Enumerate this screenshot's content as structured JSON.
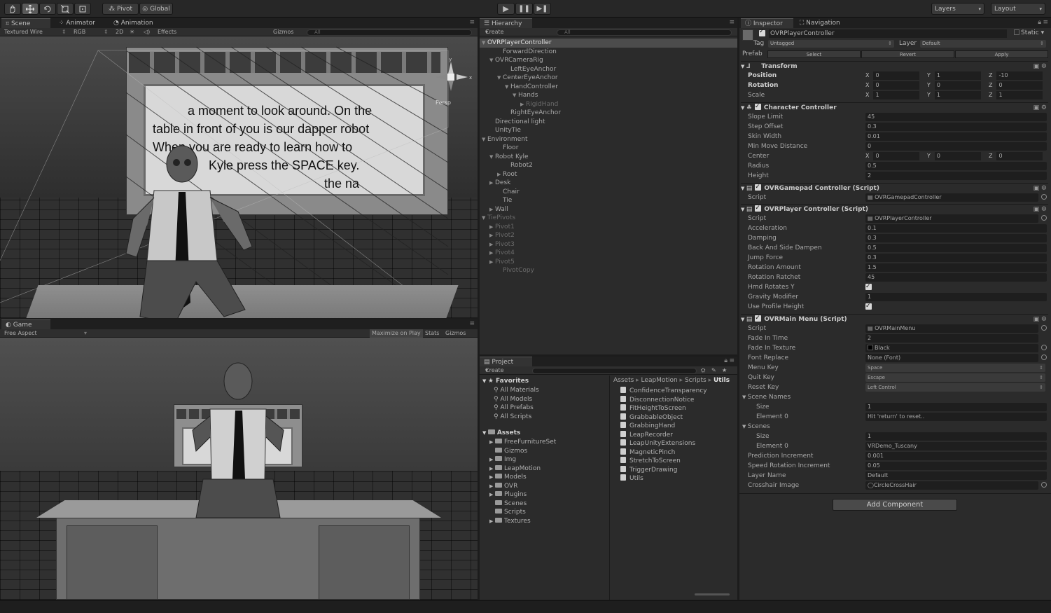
{
  "toolbar": {
    "pivot": "Pivot",
    "global": "Global",
    "layers": "Layers",
    "layout": "Layout"
  },
  "scene": {
    "tabs": [
      "Scene",
      "Animator",
      "Animation"
    ],
    "shading": "Textured Wire",
    "render_mode": "RGB",
    "mode_2d": "2D",
    "effects": "Effects",
    "gizmos": "Gizmos",
    "search": "All",
    "persp": "Persp",
    "board_text": [
      "a moment to look around. On the",
      "table in front of you is our dapper robot",
      "When you are ready to learn how to",
      "Kyle press the SPACE key.",
      "the na"
    ]
  },
  "game": {
    "tab": "Game",
    "aspect": "Free Aspect",
    "maximize": "Maximize on Play",
    "stats": "Stats",
    "gizmos": "Gizmos"
  },
  "hierarchy": {
    "tab": "Hierarchy",
    "create": "Create",
    "search": "All",
    "rows": [
      {
        "label": "OVRPlayerController",
        "indent": 0,
        "arrow": "▼",
        "selected": true
      },
      {
        "label": "ForwardDirection",
        "indent": 2,
        "arrow": ""
      },
      {
        "label": "OVRCameraRig",
        "indent": 1,
        "arrow": "▼"
      },
      {
        "label": "LeftEyeAnchor",
        "indent": 3,
        "arrow": ""
      },
      {
        "label": "CenterEyeAnchor",
        "indent": 2,
        "arrow": "▼"
      },
      {
        "label": "HandController",
        "indent": 3,
        "arrow": "▼"
      },
      {
        "label": "Hands",
        "indent": 4,
        "arrow": "▼"
      },
      {
        "label": "RigidHand",
        "indent": 5,
        "arrow": "▶",
        "dim": true
      },
      {
        "label": "RightEyeAnchor",
        "indent": 3,
        "arrow": ""
      },
      {
        "label": "Directional light",
        "indent": 1,
        "arrow": ""
      },
      {
        "label": "UnityTie",
        "indent": 1,
        "arrow": ""
      },
      {
        "label": "Environment",
        "indent": 0,
        "arrow": "▼"
      },
      {
        "label": "Floor",
        "indent": 2,
        "arrow": ""
      },
      {
        "label": "Robot Kyle",
        "indent": 1,
        "arrow": "▼"
      },
      {
        "label": "Robot2",
        "indent": 3,
        "arrow": ""
      },
      {
        "label": "Root",
        "indent": 2,
        "arrow": "▶"
      },
      {
        "label": "Desk",
        "indent": 1,
        "arrow": "▶"
      },
      {
        "label": "Chair",
        "indent": 2,
        "arrow": ""
      },
      {
        "label": "Tie",
        "indent": 2,
        "arrow": ""
      },
      {
        "label": "Wall",
        "indent": 1,
        "arrow": "▶"
      },
      {
        "label": "TiePivots",
        "indent": 0,
        "arrow": "▼",
        "dim": true
      },
      {
        "label": "Pivot1",
        "indent": 1,
        "arrow": "▶",
        "dim": true
      },
      {
        "label": "Pivot2",
        "indent": 1,
        "arrow": "▶",
        "dim": true
      },
      {
        "label": "Pivot3",
        "indent": 1,
        "arrow": "▶",
        "dim": true
      },
      {
        "label": "Pivot4",
        "indent": 1,
        "arrow": "▶",
        "dim": true
      },
      {
        "label": "Pivot5",
        "indent": 1,
        "arrow": "▶",
        "dim": true
      },
      {
        "label": "PivotCopy",
        "indent": 2,
        "arrow": "",
        "dim": true
      }
    ]
  },
  "project": {
    "tab": "Project",
    "create": "Create",
    "favorites_label": "Favorites",
    "favorites": [
      "All Materials",
      "All Models",
      "All Prefabs",
      "All Scripts"
    ],
    "assets_label": "Assets",
    "folders": [
      {
        "label": "FreeFurnitureSet",
        "arrow": "▶"
      },
      {
        "label": "Gizmos",
        "arrow": ""
      },
      {
        "label": "Img",
        "arrow": "▶"
      },
      {
        "label": "LeapMotion",
        "arrow": "▶"
      },
      {
        "label": "Models",
        "arrow": "▶"
      },
      {
        "label": "OVR",
        "arrow": "▶"
      },
      {
        "label": "Plugins",
        "arrow": "▶"
      },
      {
        "label": "Scenes",
        "arrow": ""
      },
      {
        "label": "Scripts",
        "arrow": ""
      },
      {
        "label": "Textures",
        "arrow": "▶"
      }
    ],
    "breadcrumb": [
      "Assets",
      "LeapMotion",
      "Scripts",
      "Utils"
    ],
    "files": [
      "ConfidenceTransparency",
      "DisconnectionNotice",
      "FitHeightToScreen",
      "GrabbableObject",
      "GrabbingHand",
      "LeapRecorder",
      "LeapUnityExtensions",
      "MagneticPinch",
      "StretchToScreen",
      "TriggerDrawing",
      "Utils"
    ]
  },
  "inspector": {
    "tabs": [
      "Inspector",
      "Navigation"
    ],
    "object_name": "OVRPlayerController",
    "static": "Static",
    "tag_label": "Tag",
    "tag_value": "Untagged",
    "layer_label": "Layer",
    "layer_value": "Default",
    "prefab_label": "Prefab",
    "prefab_buttons": [
      "Select",
      "Revert",
      "Apply"
    ],
    "transform": {
      "title": "Transform",
      "rows": [
        {
          "label": "Position",
          "x": "0",
          "y": "1",
          "z": "-10",
          "bold": true
        },
        {
          "label": "Rotation",
          "x": "0",
          "y": "0",
          "z": "0",
          "bold": true
        },
        {
          "label": "Scale",
          "x": "1",
          "y": "1",
          "z": "1",
          "bold": false
        }
      ]
    },
    "character_controller": {
      "title": "Character Controller",
      "rows": [
        {
          "label": "Slope Limit",
          "value": "45"
        },
        {
          "label": "Step Offset",
          "value": "0.3"
        },
        {
          "label": "Skin Width",
          "value": "0.01"
        },
        {
          "label": "Min Move Distance",
          "value": "0"
        }
      ],
      "center": {
        "label": "Center",
        "x": "0",
        "y": "0",
        "z": "0"
      },
      "rows2": [
        {
          "label": "Radius",
          "value": "0.5"
        },
        {
          "label": "Height",
          "value": "2"
        }
      ]
    },
    "gamepad": {
      "title": "OVRGamepad Controller (Script)",
      "script_label": "Script",
      "script_value": "OVRGamepadController"
    },
    "player": {
      "title": "OVRPlayer Controller (Script)",
      "script_label": "Script",
      "script_value": "OVRPlayerController",
      "rows": [
        {
          "label": "Acceleration",
          "value": "0.1"
        },
        {
          "label": "Damping",
          "value": "0.3"
        },
        {
          "label": "Back And Side Dampen",
          "value": "0.5"
        },
        {
          "label": "Jump Force",
          "value": "0.3"
        },
        {
          "label": "Rotation Amount",
          "value": "1.5"
        },
        {
          "label": "Rotation Ratchet",
          "value": "45"
        }
      ],
      "checks": [
        {
          "label": "Hmd Rotates Y",
          "checked": true
        }
      ],
      "gravity": {
        "label": "Gravity Modifier",
        "value": "1"
      },
      "profile": {
        "label": "Use Profile Height",
        "checked": true
      }
    },
    "mainmenu": {
      "title": "OVRMain Menu (Script)",
      "script_label": "Script",
      "script_value": "OVRMainMenu",
      "fade_in_time": {
        "label": "Fade In Time",
        "value": "2"
      },
      "fade_in_texture": {
        "label": "Fade In Texture",
        "value": "Black"
      },
      "font_replace": {
        "label": "Font Replace",
        "value": "None (Font)"
      },
      "menu_key": {
        "label": "Menu Key",
        "value": "Space"
      },
      "quit_key": {
        "label": "Quit Key",
        "value": "Escape"
      },
      "reset_key": {
        "label": "Reset Key",
        "value": "Left Control"
      },
      "scene_names": {
        "label": "Scene Names",
        "size_label": "Size",
        "size": "1",
        "el_label": "Element 0",
        "el_value": "Hit 'return' to reset.."
      },
      "scenes": {
        "label": "Scenes",
        "size_label": "Size",
        "size": "1",
        "el_label": "Element 0",
        "el_value": "VRDemo_Tuscany"
      },
      "prediction": {
        "label": "Prediction Increment",
        "value": "0.001"
      },
      "speed_rot": {
        "label": "Speed Rotation Increment",
        "value": "0.05"
      },
      "layer_name": {
        "label": "Layer Name",
        "value": "Default"
      },
      "crosshair": {
        "label": "Crosshair Image",
        "value": "CircleCrossHair"
      }
    },
    "add_component": "Add Component"
  }
}
